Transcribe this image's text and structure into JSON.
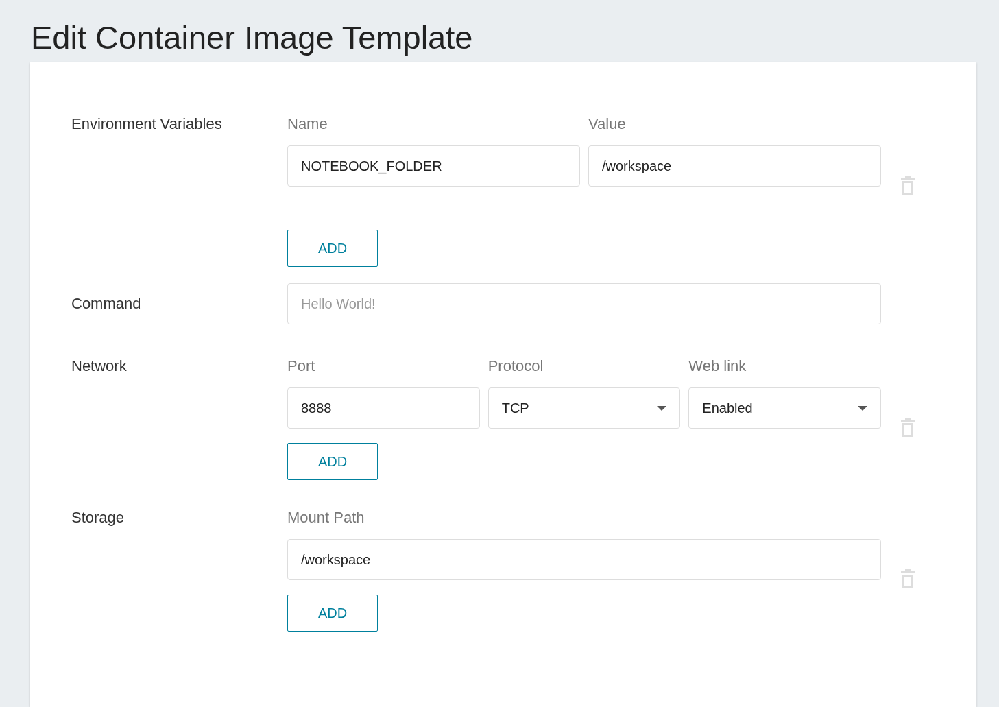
{
  "title": "Edit Container Image Template",
  "sections": [
    {
      "kind": "table",
      "label": "Environment Variables",
      "columns": [
        "Name",
        "Value"
      ],
      "rows": [
        [
          {
            "kind": "text",
            "value": "NOTEBOOK_FOLDER"
          },
          {
            "kind": "text",
            "value": "/workspace"
          }
        ]
      ],
      "add_button": "ADD"
    },
    {
      "kind": "single",
      "label": "Command",
      "field": {
        "placeholder": "Hello World!"
      }
    },
    {
      "kind": "table",
      "label": "Network",
      "columns": [
        "Port",
        "Protocol",
        "Web link"
      ],
      "rows": [
        [
          {
            "kind": "text",
            "value": "8888"
          },
          {
            "kind": "select",
            "value": "TCP"
          },
          {
            "kind": "select",
            "value": "Enabled"
          }
        ]
      ],
      "add_button": "ADD"
    },
    {
      "kind": "table",
      "label": "Storage",
      "columns": [
        "Mount Path"
      ],
      "rows": [
        [
          {
            "kind": "text",
            "value": "/workspace"
          }
        ]
      ],
      "add_button": "ADD"
    }
  ]
}
